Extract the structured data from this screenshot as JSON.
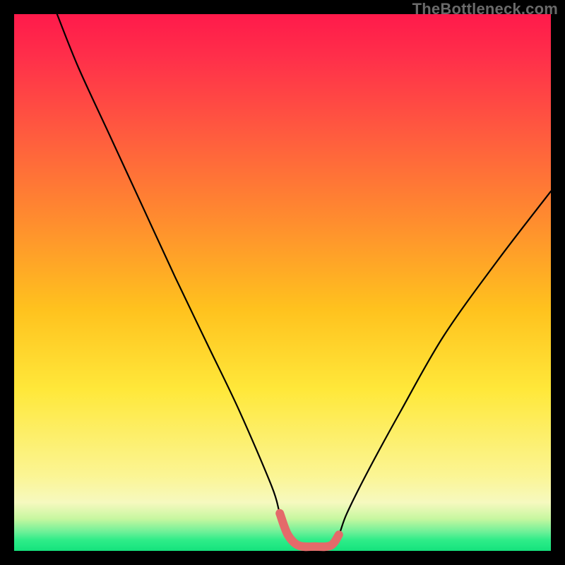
{
  "watermark": "TheBottleneck.com",
  "chart_data": {
    "type": "line",
    "title": "",
    "xlabel": "",
    "ylabel": "",
    "xlim": [
      0,
      100
    ],
    "ylim": [
      0,
      100
    ],
    "series": [
      {
        "name": "black-curve",
        "color": "#000000",
        "x": [
          8,
          12,
          18,
          24,
          30,
          36,
          42,
          48,
          49.5,
          51,
          53,
          56,
          59,
          60.5,
          62,
          66,
          72,
          80,
          90,
          100
        ],
        "y": [
          100,
          90,
          77,
          64,
          51,
          38.5,
          26,
          12,
          7,
          3,
          1,
          0.8,
          1,
          3,
          7,
          15,
          26,
          40,
          54,
          67
        ]
      },
      {
        "name": "red-bottom-segment",
        "color": "#e46a6a",
        "x": [
          49.5,
          51,
          53,
          56,
          59,
          60.5
        ],
        "y": [
          7,
          3,
          1,
          0.8,
          1,
          3
        ]
      }
    ]
  }
}
